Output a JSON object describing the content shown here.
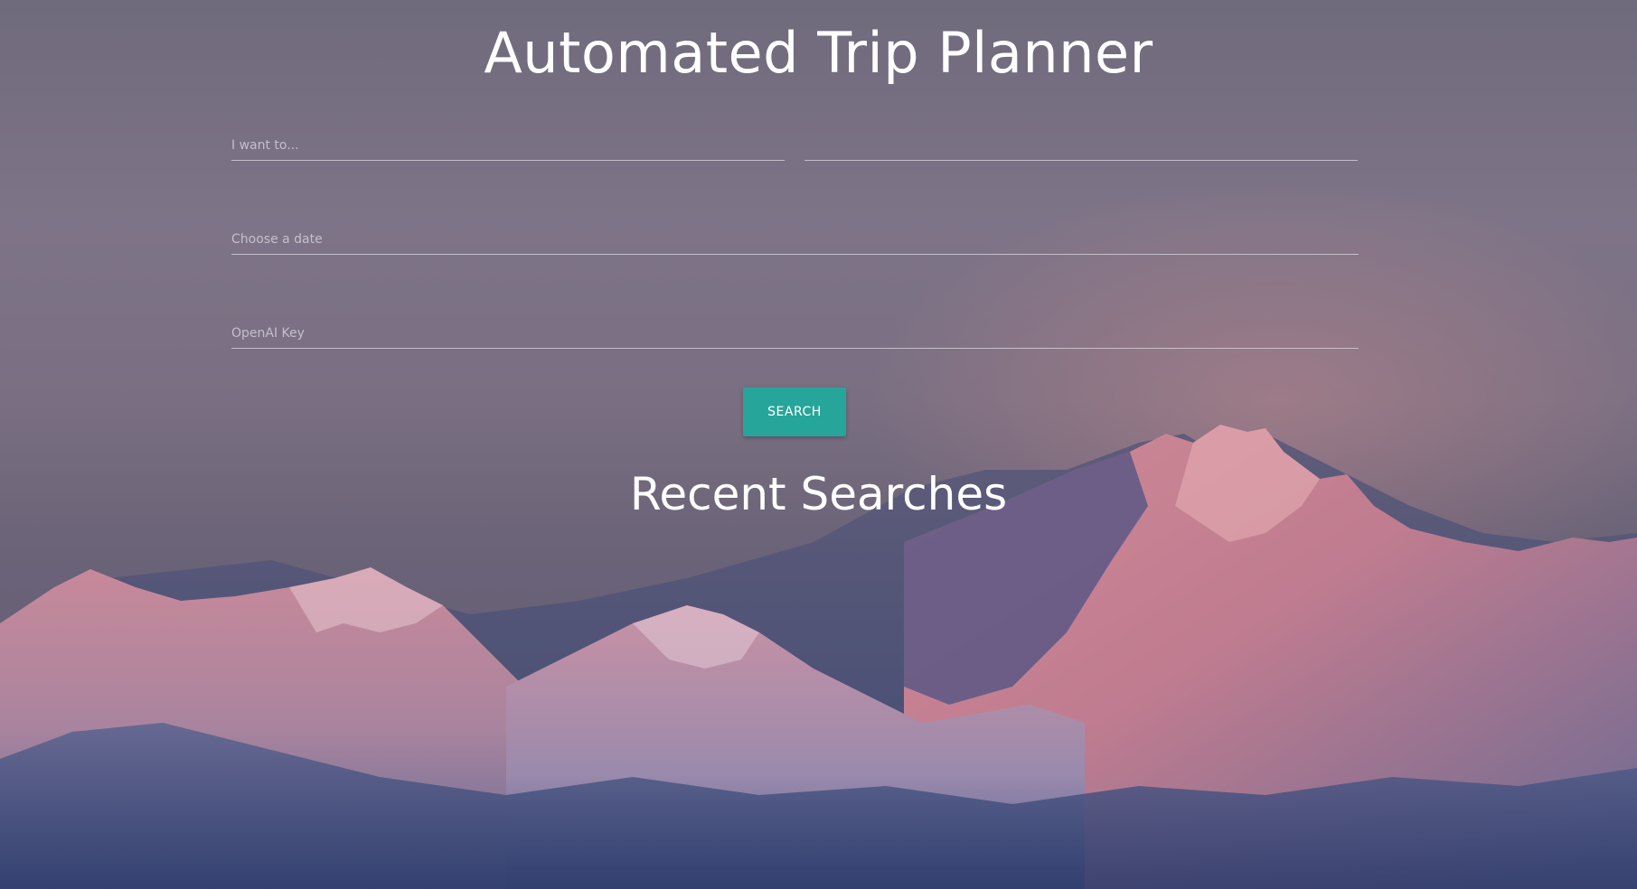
{
  "header": {
    "title": "Automated Trip Planner"
  },
  "form": {
    "intent_placeholder": "I want to...",
    "intent_value": "",
    "location_placeholder": "",
    "location_value": "",
    "date_placeholder": "Choose a date",
    "date_value": "",
    "key_placeholder": "OpenAI Key",
    "key_value": ""
  },
  "search_button": {
    "label": "SEARCH",
    "color": "#26a69a"
  },
  "recent": {
    "heading": "Recent Searches"
  }
}
